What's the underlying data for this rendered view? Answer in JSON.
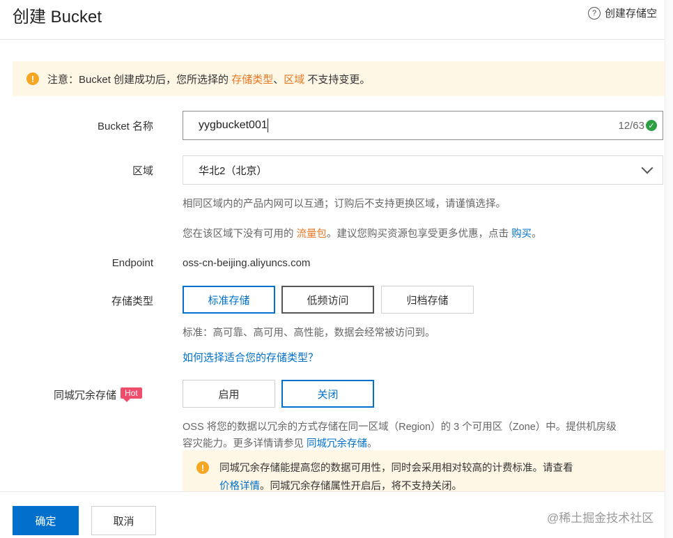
{
  "header": {
    "title": "创建 Bucket",
    "help_label": "创建存储空",
    "help_icon": "question-circle-icon"
  },
  "notice": {
    "prefix": "注意：Bucket 创建成功后，您所选择的 ",
    "highlight1": "存储类型",
    "sep": "、",
    "highlight2": "区域",
    "suffix": " 不支持变更。"
  },
  "bucket_name": {
    "label": "Bucket 名称",
    "value": "yygbucket001",
    "counter": "12/63"
  },
  "region": {
    "label": "区域",
    "selected": "华北2（北京）",
    "hint": "相同区域内的产品内网可以互通；订购后不支持更换区域，请谨慎选择。",
    "promo_prefix": "您在该区域下没有可用的 ",
    "promo_link": "流量包",
    "promo_middle": "。建议您购买资源包享受更多优惠，点击 ",
    "promo_buy": "购买",
    "promo_end": "。"
  },
  "endpoint": {
    "label": "Endpoint",
    "value": "oss-cn-beijing.aliyuncs.com"
  },
  "storage_class": {
    "label": "存储类型",
    "options": [
      "标准存储",
      "低频访问",
      "归档存储"
    ],
    "selected": "标准存储",
    "hint": "标准：高可靠、高可用、高性能，数据会经常被访问到。",
    "link": "如何选择适合您的存储类型？"
  },
  "redundancy": {
    "label": "同城冗余存储",
    "badge": "Hot",
    "options": [
      "启用",
      "关闭"
    ],
    "selected": "关闭",
    "desc_line1": "OSS 将您的数据以冗余的方式存储在同一区域（Region）的 3 个可用区（Zone）中。提供机房级",
    "desc_line2_prefix": "容灾能力。更多详情请参见 ",
    "desc_link": "同城冗余存储",
    "desc_end": "。",
    "warn_line1": "同城冗余存储能提高您的数据可用性，同时会采用相对较高的计费标准。请查看",
    "warn_link": "价格详情",
    "warn_line2": "。同城冗余存储属性开启后，将不支持关闭。"
  },
  "footer": {
    "confirm": "确定",
    "cancel": "取消"
  },
  "watermark": "@稀土掘金技术社区",
  "colors": {
    "accent": "#0070cc",
    "warning_bg": "#fff7e6",
    "orange": "#e87722",
    "hot_badge": "#f04c6b"
  }
}
